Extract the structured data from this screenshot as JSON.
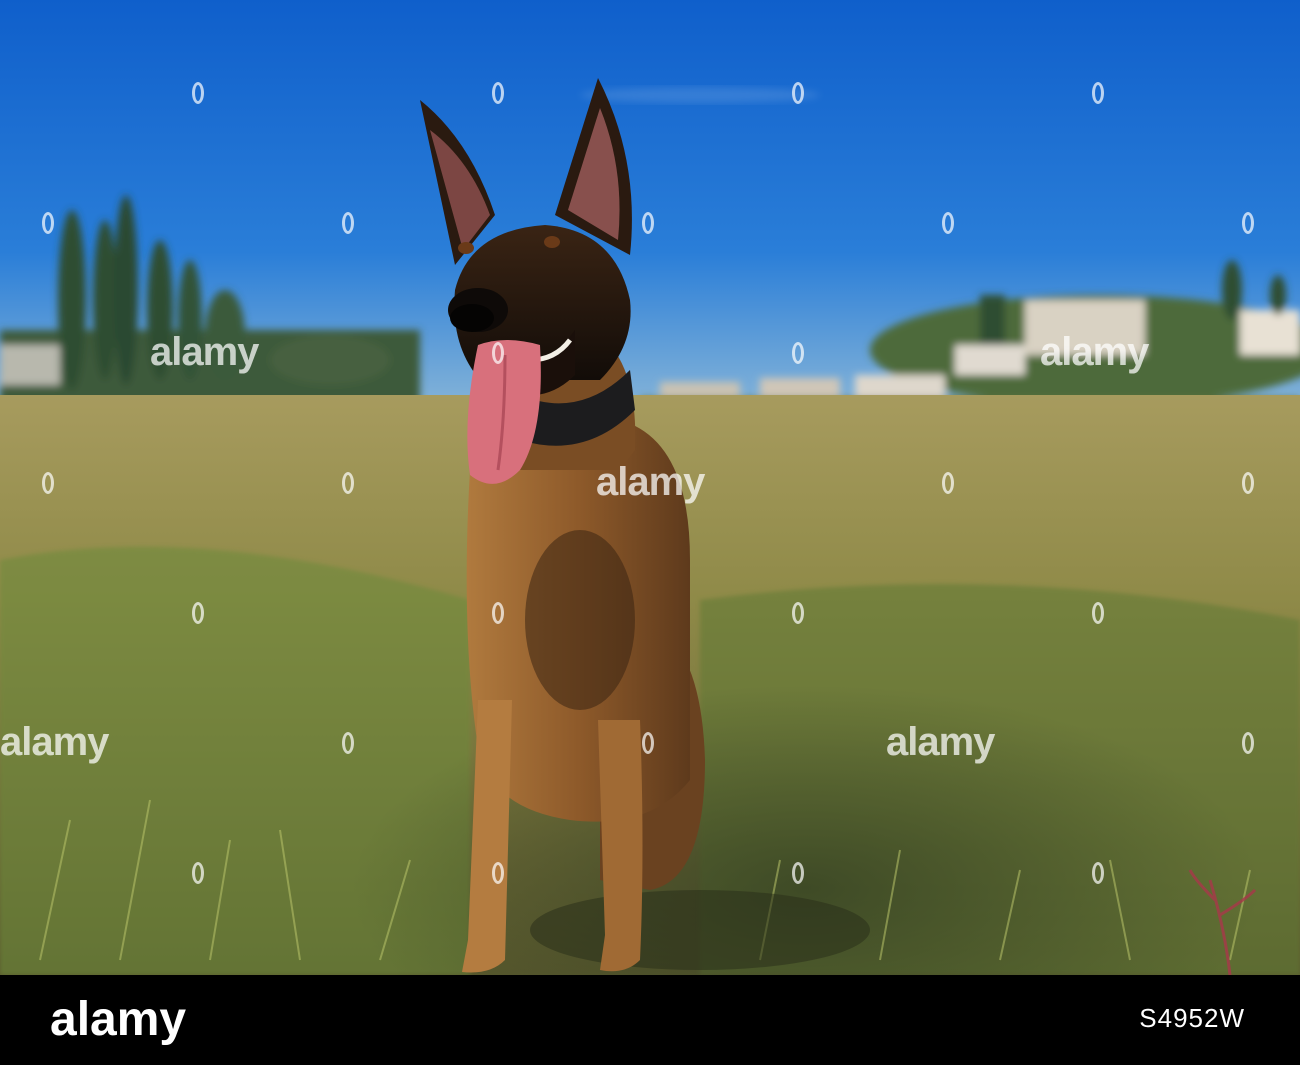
{
  "image": {
    "subject": "dog",
    "colors": {
      "sky": "#1a6fd6",
      "grass": "#8f8a45",
      "coat": "#9a6430",
      "tongue": "#d8707c"
    }
  },
  "watermark": {
    "text": "alamy"
  },
  "footer": {
    "logo_text": "alamy",
    "image_id": "S4952W"
  }
}
